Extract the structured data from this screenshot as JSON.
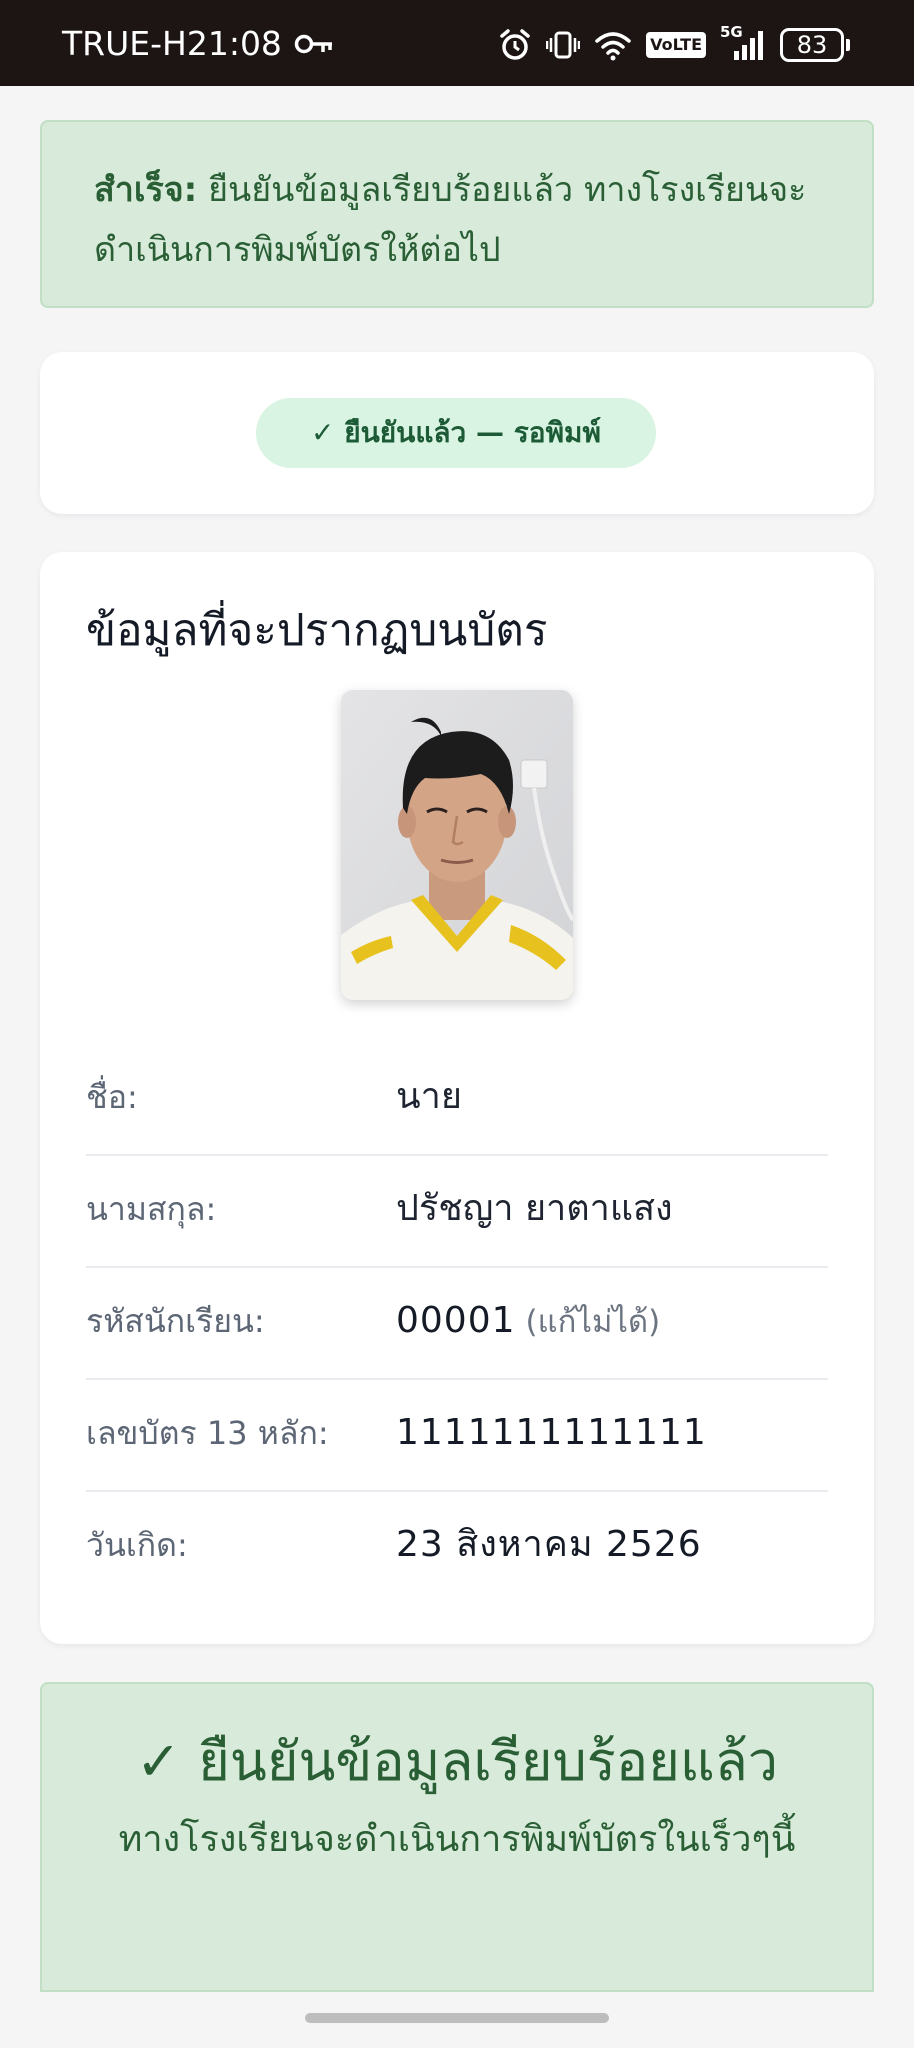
{
  "status_bar": {
    "carrier": "TRUE-H",
    "time": "21:08",
    "network": "5G",
    "volte": "VoLTE",
    "battery": "83",
    "icons": [
      "key-icon",
      "alarm-icon",
      "vibrate-icon",
      "wifi-icon",
      "volte-icon",
      "signal-icon",
      "battery-icon"
    ]
  },
  "alert": {
    "prefix": "สำเร็จ:",
    "message": "ยืนยันข้อมูลเรียบร้อยแล้ว ทางโรงเรียนจะดำเนินการพิมพ์บัตรให้ต่อไป"
  },
  "status_badge": "✓ ยืนยันแล้ว — รอพิมพ์",
  "info_card": {
    "title": "ข้อมูลที่จะปรากฏบนบัตร",
    "rows": [
      {
        "label": "ชื่อ:",
        "value": "นาย",
        "note": ""
      },
      {
        "label": "นามสกุล:",
        "value": "ปรัชญา ยาตาแสง",
        "note": ""
      },
      {
        "label": "รหัสนักเรียน:",
        "value": "00001",
        "note": "(แก้ไม่ได้)"
      },
      {
        "label": "เลขบัตร 13 หลัก:",
        "value": "1111111111111",
        "note": ""
      },
      {
        "label": "วันเกิด:",
        "value": "23 สิงหาคม 2526",
        "note": ""
      }
    ]
  },
  "confirm_panel": {
    "heading": "✓ ยืนยันข้อมูลเรียบร้อยแล้ว",
    "text": "ทางโรงเรียนจะดำเนินการพิมพ์บัตรในเร็วๆนี้"
  },
  "colors": {
    "success_bg": "#d8ebda",
    "success_text": "#2a5f35",
    "badge_bg": "#d9f4e3",
    "status_bar_bg": "#1c1514"
  }
}
